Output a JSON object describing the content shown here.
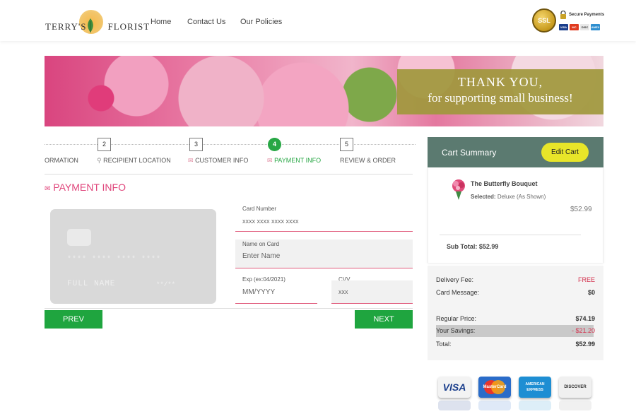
{
  "brand": {
    "logo_left": "TERRY'S",
    "logo_right": "FLORIST"
  },
  "nav": {
    "items": [
      {
        "label": "Home"
      },
      {
        "label": "Contact Us"
      },
      {
        "label": "Our Policies"
      }
    ]
  },
  "secure": {
    "badge": "SSL",
    "label": "Secure Payments",
    "cards": [
      "VISA",
      "MC",
      "DISC",
      "AMEX"
    ]
  },
  "banner": {
    "line1": "THANK YOU,",
    "line2": "for supporting small business!"
  },
  "steps": [
    {
      "number": "",
      "label": "ORMATION"
    },
    {
      "number": "2",
      "label": "RECIPIENT LOCATION"
    },
    {
      "number": "3",
      "label": "CUSTOMER INFO"
    },
    {
      "number": "4",
      "label": "PAYMENT INFO"
    },
    {
      "number": "5",
      "label": "REVIEW & ORDER"
    }
  ],
  "section": {
    "title": "PAYMENT INFO"
  },
  "card_preview": {
    "number": "**** **** **** ****",
    "name": "FULL NAME",
    "expiry": "**/**"
  },
  "form": {
    "card_number": {
      "label": "Card Number",
      "placeholder": "xxxx xxxx xxxx xxxx"
    },
    "name_on_card": {
      "label": "Name on Card",
      "placeholder": "Enter Name"
    },
    "exp": {
      "label": "Exp (ex:04/2021)",
      "placeholder": "MM/YYYY"
    },
    "cvv": {
      "label": "CVV",
      "placeholder": "xxx"
    }
  },
  "buttons": {
    "prev": "PREV",
    "next": "NEXT"
  },
  "cart": {
    "title": "Cart Summary",
    "edit_label": "Edit Cart",
    "product": {
      "name": "The Butterfly Bouquet",
      "selected_label": "Selected:",
      "selected_value": "Deluxe (As Shown)",
      "price": "$52.99"
    },
    "subtotal": "Sub Total: $52.99"
  },
  "totals": {
    "delivery_label": "Delivery Fee:",
    "delivery_value": "FREE",
    "message_label": "Card Message:",
    "message_value": "$0",
    "regular_label": "Regular Price:",
    "regular_value": "$74.19",
    "savings_label": "Your Savings:",
    "savings_value": "- $21.20",
    "total_label": "Total:",
    "total_value": "$52.99"
  },
  "colors": {
    "accent_green": "#1fa53f",
    "accent_pink": "#e0457b",
    "cart_header": "#5b7a70",
    "edit_button": "#e8e529",
    "banner_box": "#9f983c"
  },
  "payment_logos": [
    "VISA",
    "MasterCard",
    "AMERICAN EXPRESS",
    "DISCOVER"
  ]
}
